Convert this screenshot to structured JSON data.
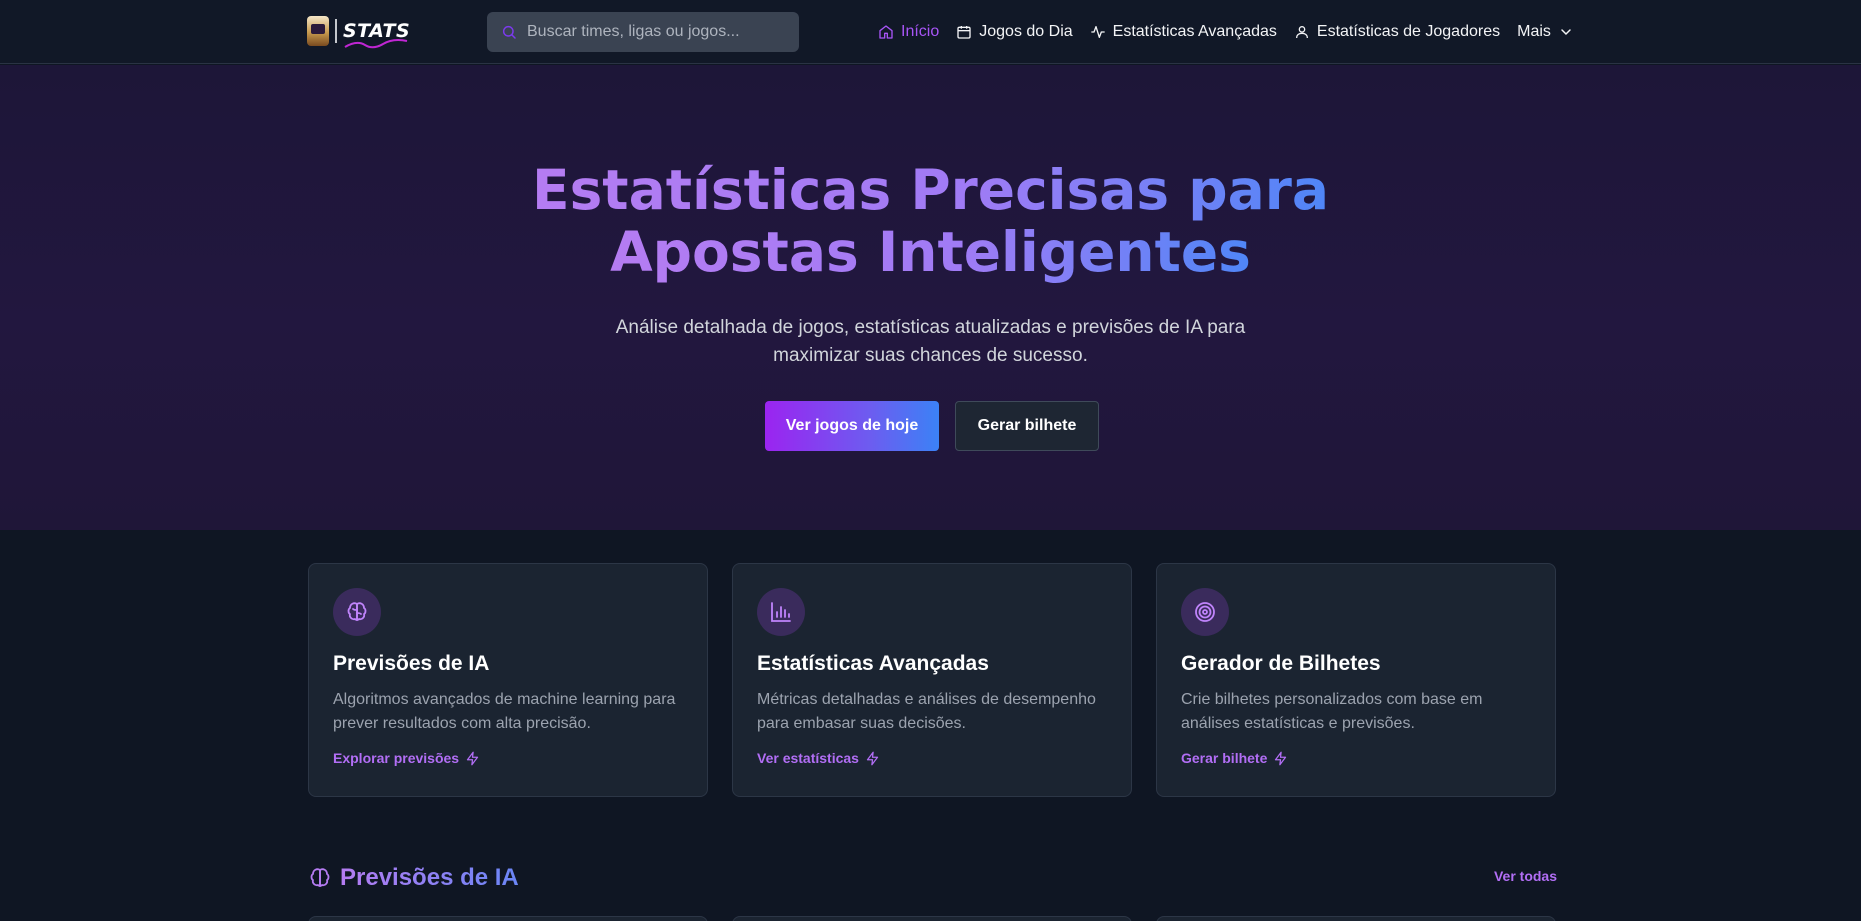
{
  "header": {
    "logo_text": "STATS",
    "search_placeholder": "Buscar times, ligas ou jogos...",
    "nav": [
      {
        "label": "Início",
        "icon": "home-icon",
        "active": true
      },
      {
        "label": "Jogos do Dia",
        "icon": "calendar-icon"
      },
      {
        "label": "Estatísticas Avançadas",
        "icon": "activity-icon"
      },
      {
        "label": "Estatísticas de Jogadores",
        "icon": "user-icon"
      },
      {
        "label": "Mais",
        "icon": "chevron-down-icon"
      }
    ]
  },
  "hero": {
    "title_line1": "Estatísticas Precisas para",
    "title_line2": "Apostas Inteligentes",
    "subtitle": "Análise detalhada de jogos, estatísticas atualizadas e previsões de IA para maximizar suas chances de sucesso.",
    "primary_button": "Ver jogos de hoje",
    "secondary_button": "Gerar bilhete"
  },
  "features": [
    {
      "icon": "brain-icon",
      "title": "Previsões de IA",
      "description": "Algoritmos avançados de machine learning para prever resultados com alta precisão.",
      "link": "Explorar previsões"
    },
    {
      "icon": "bar-chart-icon",
      "title": "Estatísticas Avançadas",
      "description": "Métricas detalhadas e análises de desempenho para embasar suas decisões.",
      "link": "Ver estatísticas"
    },
    {
      "icon": "target-icon",
      "title": "Gerador de Bilhetes",
      "description": "Crie bilhetes personalizados com base em análises estatísticas e previsões.",
      "link": "Gerar bilhete"
    }
  ],
  "section": {
    "icon": "brain-icon",
    "title": "Previsões de IA",
    "see_all": "Ver todas"
  },
  "colors": {
    "accent": "#a855f7",
    "link": "#b26ef5",
    "background": "#0f1623",
    "card": "#1b2431",
    "hero": "#22173f"
  }
}
